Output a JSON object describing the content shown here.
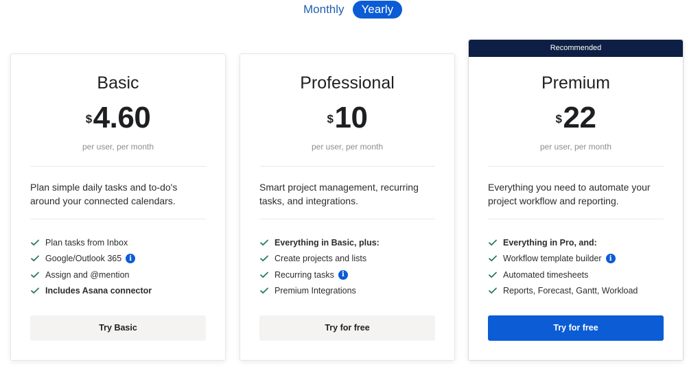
{
  "billing_toggle": {
    "monthly_label": "Monthly",
    "yearly_label": "Yearly",
    "selected": "Yearly"
  },
  "colors": {
    "accent": "#0b5cd5",
    "banner": "#0d1f44",
    "check": "#2a7d5f"
  },
  "plans": [
    {
      "name": "Basic",
      "currency": "$",
      "price": "4.60",
      "period": "per user, per month",
      "description": "Plan simple daily tasks and to-do's around your connected calendars.",
      "features": [
        {
          "text": "Plan tasks from Inbox",
          "bold": false,
          "info": false
        },
        {
          "text": "Google/Outlook 365",
          "bold": false,
          "info": true
        },
        {
          "text": "Assign and @mention",
          "bold": false,
          "info": false
        },
        {
          "text": "Includes Asana connector",
          "bold": true,
          "info": false
        }
      ],
      "cta": "Try Basic"
    },
    {
      "name": "Professional",
      "currency": "$",
      "price": "10",
      "period": "per user, per month",
      "description": "Smart project management, recurring tasks, and integrations.",
      "features": [
        {
          "text": "Everything in Basic, plus:",
          "bold": true,
          "info": false
        },
        {
          "text": "Create projects and lists",
          "bold": false,
          "info": false
        },
        {
          "text": "Recurring tasks",
          "bold": false,
          "info": true
        },
        {
          "text": "Premium Integrations",
          "bold": false,
          "info": false
        }
      ],
      "cta": "Try for free"
    },
    {
      "name": "Premium",
      "badge": "Recommended",
      "currency": "$",
      "price": "22",
      "period": "per user, per month",
      "description": "Everything you need to automate your project workflow and reporting.",
      "features": [
        {
          "text": "Everything in Pro, and:",
          "bold": true,
          "info": false
        },
        {
          "text": "Workflow template builder",
          "bold": false,
          "info": true
        },
        {
          "text": "Automated timesheets",
          "bold": false,
          "info": false
        },
        {
          "text": "Reports, Forecast, Gantt, Workload",
          "bold": false,
          "info": false
        }
      ],
      "cta": "Try for free"
    }
  ]
}
